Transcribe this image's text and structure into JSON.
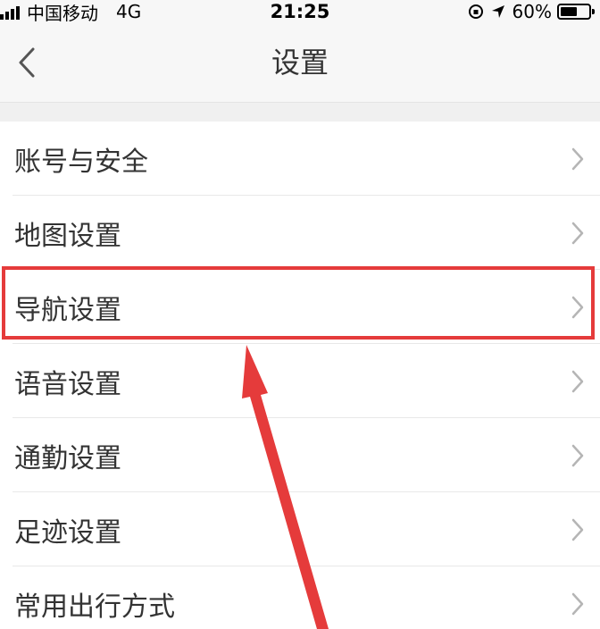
{
  "status_bar": {
    "carrier": "中国移动",
    "network": "4G",
    "time": "21:25",
    "battery": "60%",
    "battery_level": 0.6
  },
  "nav": {
    "title": "设置",
    "back_icon": "chevron-left-icon"
  },
  "settings": {
    "items": [
      {
        "label": "账号与安全"
      },
      {
        "label": "地图设置"
      },
      {
        "label": "导航设置"
      },
      {
        "label": "语音设置"
      },
      {
        "label": "通勤设置"
      },
      {
        "label": "足迹设置"
      },
      {
        "label": "常用出行方式"
      }
    ]
  },
  "annotation": {
    "highlight_color": "#e53b3b",
    "highlighted_item": "导航设置"
  }
}
